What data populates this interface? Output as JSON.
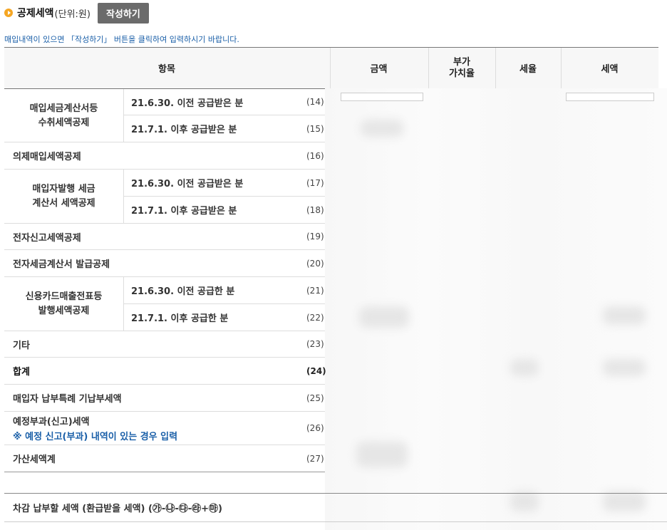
{
  "header": {
    "title": "공제세액",
    "unit": "(단위:원)",
    "write_button": "작성하기"
  },
  "notice": "매입내역이 있으면 「작성하기」 버튼을 클릭하여 입력하시기 바랍니다.",
  "columns": {
    "item": "항목",
    "amount": "금액",
    "vat_rate": "부가\n가치율",
    "tax_rate": "세율",
    "tax": "세액"
  },
  "rows": {
    "r14_group": "매입세금계산서등\n수취세액공제",
    "r14_sub": "21.6.30. 이전 공급받은 분",
    "r14_num": "(14)",
    "r15_sub": "21.7.1. 이후 공급받은 분",
    "r15_num": "(15)",
    "r16": "의제매입세액공제",
    "r16_num": "(16)",
    "r17_group": "매입자발행 세금\n계산서 세액공제",
    "r17_sub": "21.6.30. 이전 공급받은 분",
    "r17_num": "(17)",
    "r18_sub": "21.7.1. 이후 공급받은 분",
    "r18_num": "(18)",
    "r19": "전자신고세액공제",
    "r19_num": "(19)",
    "r20": "전자세금계산서 발급공제",
    "r20_num": "(20)",
    "r21_group": "신용카드매출전표등\n발행세액공제",
    "r21_sub": "21.6.30. 이전 공급한 분",
    "r21_num": "(21)",
    "r22_sub": "21.7.1. 이후 공급한 분",
    "r22_num": "(22)",
    "r23": "기타",
    "r23_num": "(23)",
    "r24": "합계",
    "r24_num": "(24)",
    "r25": "매입자 납부특례 기납부세액",
    "r25_num": "(25)",
    "r26": "예정부과(신고)세액",
    "r26_note": "※ 예정 신고(부과) 내역이 있는 경우 입력",
    "r26_num": "(26)",
    "r27": "가산세액계",
    "r27_num": "(27)",
    "final": "차감 납부할 세액 (환급받을 세액) (㉮-㉯-㉰-㉱+㉲)"
  }
}
